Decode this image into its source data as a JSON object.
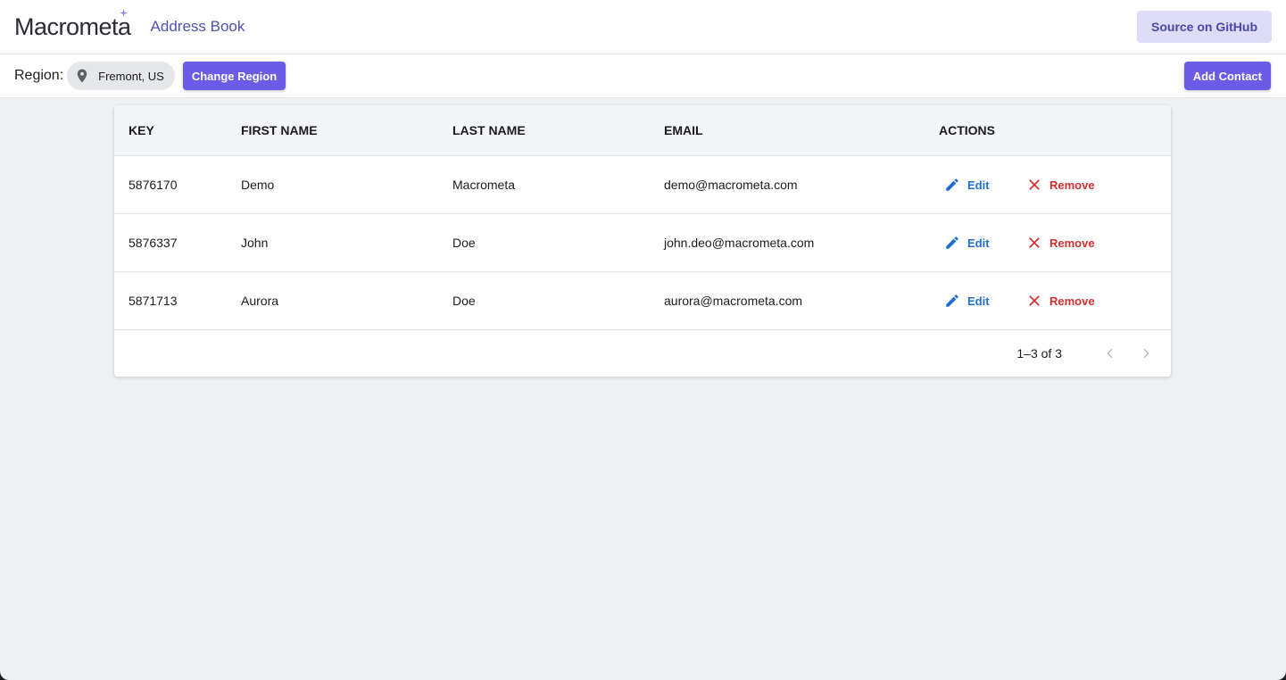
{
  "header": {
    "logo_text": "Macrometa",
    "app_title": "Address Book",
    "github_button": "Source on GitHub"
  },
  "toolbar": {
    "region_label": "Region:",
    "region_value": "Fremont, US",
    "change_region_button": "Change Region",
    "add_contact_button": "Add Contact"
  },
  "table": {
    "columns": [
      "KEY",
      "FIRST NAME",
      "LAST NAME",
      "EMAIL",
      "ACTIONS"
    ],
    "rows": [
      {
        "key": "5876170",
        "first_name": "Demo",
        "last_name": "Macrometa",
        "email": "demo@macrometa.com"
      },
      {
        "key": "5876337",
        "first_name": "John",
        "last_name": "Doe",
        "email": "john.deo@macrometa.com"
      },
      {
        "key": "5871713",
        "first_name": "Aurora",
        "last_name": "Doe",
        "email": "aurora@macrometa.com"
      }
    ],
    "edit_label": "Edit",
    "remove_label": "Remove",
    "pagination": "1–3 of 3"
  },
  "colors": {
    "accent": "#6b5ce7",
    "edit": "#1f6fd1",
    "remove": "#d32f2f",
    "github_bg": "#dedcf7"
  },
  "icons": [
    "location-pin-icon",
    "pencil-icon",
    "close-icon",
    "chevron-left-icon",
    "chevron-right-icon",
    "sparkle-icon"
  ]
}
